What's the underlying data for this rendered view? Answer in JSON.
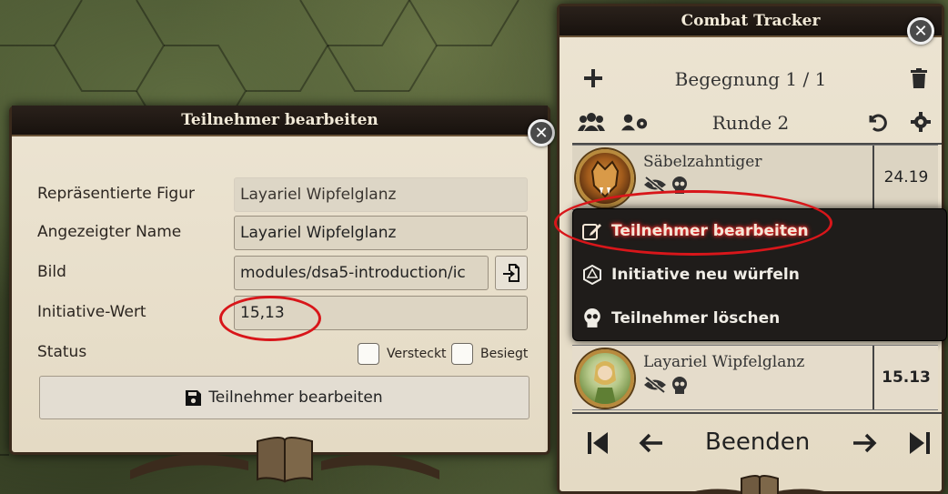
{
  "edit_dialog": {
    "title": "Teilnehmer bearbeiten",
    "close_icon": "close-icon",
    "fields": {
      "actor_label": "Repräsentierte Figur",
      "actor_value": "Layariel Wipfelglanz",
      "name_label": "Angezeigter Name",
      "name_value": "Layariel Wipfelglanz",
      "image_label": "Bild",
      "image_value": "modules/dsa5-introduction/ic",
      "initiative_label": "Initiative-Wert",
      "initiative_value": "15,13",
      "status_label": "Status",
      "hidden_label": "Versteckt",
      "defeated_label": "Besiegt"
    },
    "submit_label": "Teilnehmer bearbeiten"
  },
  "combat_tracker": {
    "title": "Combat Tracker",
    "encounter_label": "Begegnung 1 / 1",
    "round_label": "Runde 2",
    "combatants": [
      {
        "name": "Säbelzahntiger",
        "initiative": "24.19"
      },
      {
        "name": "Layariel Wipfelglanz",
        "initiative": "15.13"
      }
    ],
    "context_menu": [
      {
        "label": "Teilnehmer bearbeiten",
        "icon": "edit-icon"
      },
      {
        "label": "Initiative neu würfeln",
        "icon": "dice-icon"
      },
      {
        "label": "Teilnehmer löschen",
        "icon": "skull-icon"
      }
    ],
    "end_label": "Beenden"
  },
  "colors": {
    "annotation": "#d8161a",
    "header": "#1f1814",
    "parchment": "#e8dfcb"
  }
}
